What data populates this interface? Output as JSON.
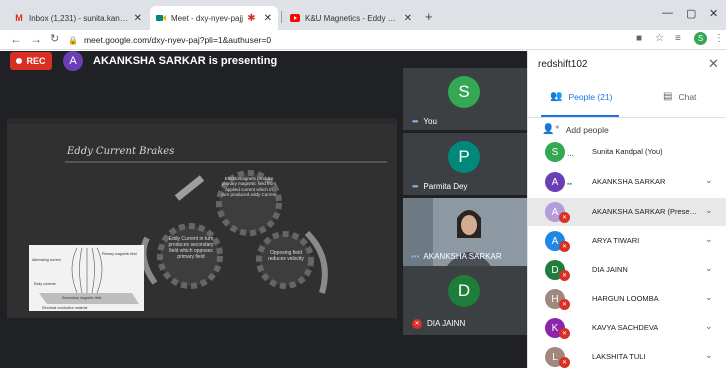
{
  "browser": {
    "tabs": [
      {
        "label": "Inbox (1,231) - sunita.kandpal@",
        "icon": "gmail-icon"
      },
      {
        "label": "Meet - dxy-nyev-pajj",
        "icon": "meet-icon"
      },
      {
        "label": "K&U Magnetics - Eddy Current D",
        "icon": "youtube-icon"
      }
    ],
    "url": "meet.google.com/dxy-nyev-paj?pli=1&authuser=0",
    "profile_initial": "S"
  },
  "meet": {
    "rec_label": "REC",
    "presenter_initial": "A",
    "presenting_text": "AKANKSHA SARKAR is presenting",
    "slide": {
      "title": "Eddy Current Brakes",
      "gear_top": "Electromagnets produce primary magnetic field from applied current which in turn produced eddy Current",
      "gear_left": "Eddy Current in turn produces secondary field which opposes primary field",
      "gear_right": "Opposing field reduces velocity",
      "diagram_labels": {
        "primary": "Primary magnetic field",
        "alternating": "Alternating current",
        "eddy": "Eddy currents",
        "secondary": "Secondary magnetic field",
        "conductor": "Electrical conductive material"
      }
    },
    "tiles": [
      {
        "initial": "S",
        "name": "You",
        "color": "#34a853"
      },
      {
        "initial": "P",
        "name": "Parmita Dey",
        "color": "#00897b"
      },
      {
        "name": "AKANKSHA SARKAR"
      },
      {
        "initial": "D",
        "name": "DIA JAINN",
        "color": "#1e7d3a"
      }
    ]
  },
  "panel": {
    "title": "redshift102",
    "tab_people": "People (21)",
    "tab_chat": "Chat",
    "add_people": "Add people",
    "people": [
      {
        "initial": "S",
        "name": "Sunita Kandpal (You)",
        "color": "#34a853",
        "status": "dots"
      },
      {
        "initial": "A",
        "name": "AKANKSHA SARKAR",
        "color": "#6a3fb5",
        "status": "speaking"
      },
      {
        "initial": "A",
        "name": "AKANKSHA SARKAR (Presenta...",
        "color": "#b39ddb",
        "status": "muted"
      },
      {
        "initial": "A",
        "name": "ARYA TIWARI",
        "color": "#1e88e5",
        "status": "muted"
      },
      {
        "initial": "D",
        "name": "DIA JAINN",
        "color": "#1e7d3a",
        "status": "muted"
      },
      {
        "initial": "H",
        "name": "HARGUN LOOMBA",
        "color": "#a1887f",
        "status": "muted"
      },
      {
        "initial": "K",
        "name": "KAVYA SACHDEVA",
        "color": "#8e24aa",
        "status": "muted"
      },
      {
        "initial": "L",
        "name": "LAKSHITA TULI",
        "color": "#a1887f",
        "status": "muted"
      }
    ]
  }
}
